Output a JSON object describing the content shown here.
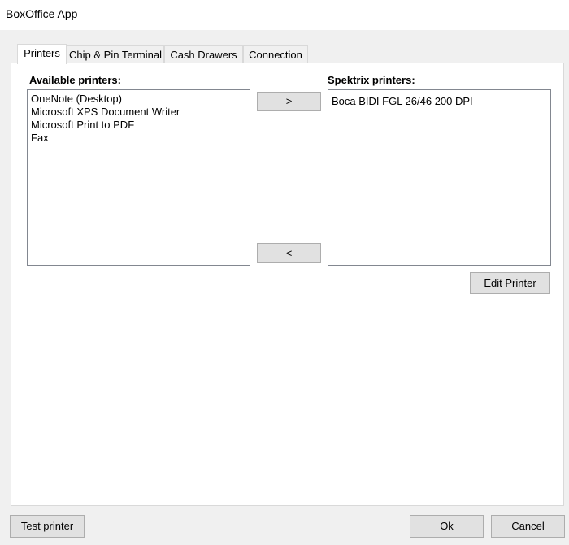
{
  "window": {
    "title": "BoxOffice App"
  },
  "tabs": [
    {
      "label": "Printers",
      "active": true
    },
    {
      "label": "Chip & Pin Terminal",
      "active": false
    },
    {
      "label": "Cash Drawers",
      "active": false
    },
    {
      "label": "Connection",
      "active": false
    }
  ],
  "printers": {
    "available_label": "Available printers:",
    "available": [
      "OneNote (Desktop)",
      "Microsoft XPS Document Writer",
      "Microsoft Print to PDF",
      "Fax"
    ],
    "spektrix_label": "Spektrix printers:",
    "spektrix": [
      "Boca BIDI FGL 26/46 200 DPI"
    ],
    "move_right_label": ">",
    "move_left_label": "<",
    "edit_printer_label": "Edit Printer"
  },
  "footer": {
    "test_printer_label": "Test printer",
    "ok_label": "Ok",
    "cancel_label": "Cancel"
  }
}
